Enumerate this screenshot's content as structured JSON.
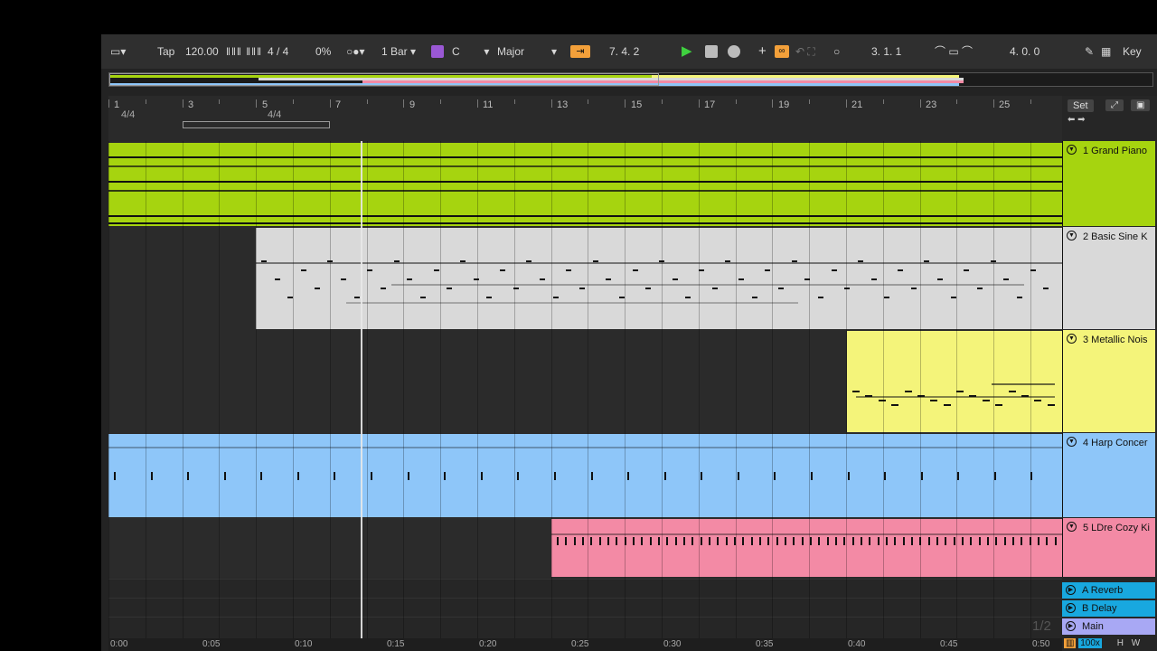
{
  "toolbar": {
    "tap_label": "Tap",
    "tempo": "120.00",
    "time_signature": "4 / 4",
    "groove_amount": "0%",
    "quantize": "1 Bar",
    "scale_root": "C",
    "scale_mode": "Major",
    "arrangement_position": "7.   4.   2",
    "loop_start": "3.   1.   1",
    "loop_length": "4.   0.   0",
    "key_label": "Key"
  },
  "ruler": {
    "bars": [
      "1",
      "3",
      "5",
      "7",
      "9",
      "11",
      "13",
      "15",
      "17",
      "19",
      "21",
      "23",
      "25"
    ],
    "signature_start": "4/4",
    "signature_change": "4/4"
  },
  "tracks": [
    {
      "name": "1 Grand Piano",
      "color": "#a6d40f"
    },
    {
      "name": "2 Basic Sine K",
      "color": "#d9d9d9"
    },
    {
      "name": "3 Metallic Nois",
      "color": "#f4f47a"
    },
    {
      "name": "4 Harp Concer",
      "color": "#8ec6f9"
    },
    {
      "name": "5 LDre Cozy Ki",
      "color": "#f38aa5"
    }
  ],
  "returns": [
    {
      "name": "A Reverb",
      "color": "#18a8df"
    },
    {
      "name": "B Delay",
      "color": "#18a8df"
    },
    {
      "name": "Main",
      "color": "#a8a8f4"
    }
  ],
  "side": {
    "set_label": "Set",
    "page_indicator": "1/2",
    "zoom_label": "100x",
    "h_label": "H",
    "w_label": "W"
  },
  "time_labels": [
    "0:00",
    "0:05",
    "0:10",
    "0:15",
    "0:20",
    "0:25",
    "0:30",
    "0:35",
    "0:40",
    "0:45",
    "0:50"
  ]
}
